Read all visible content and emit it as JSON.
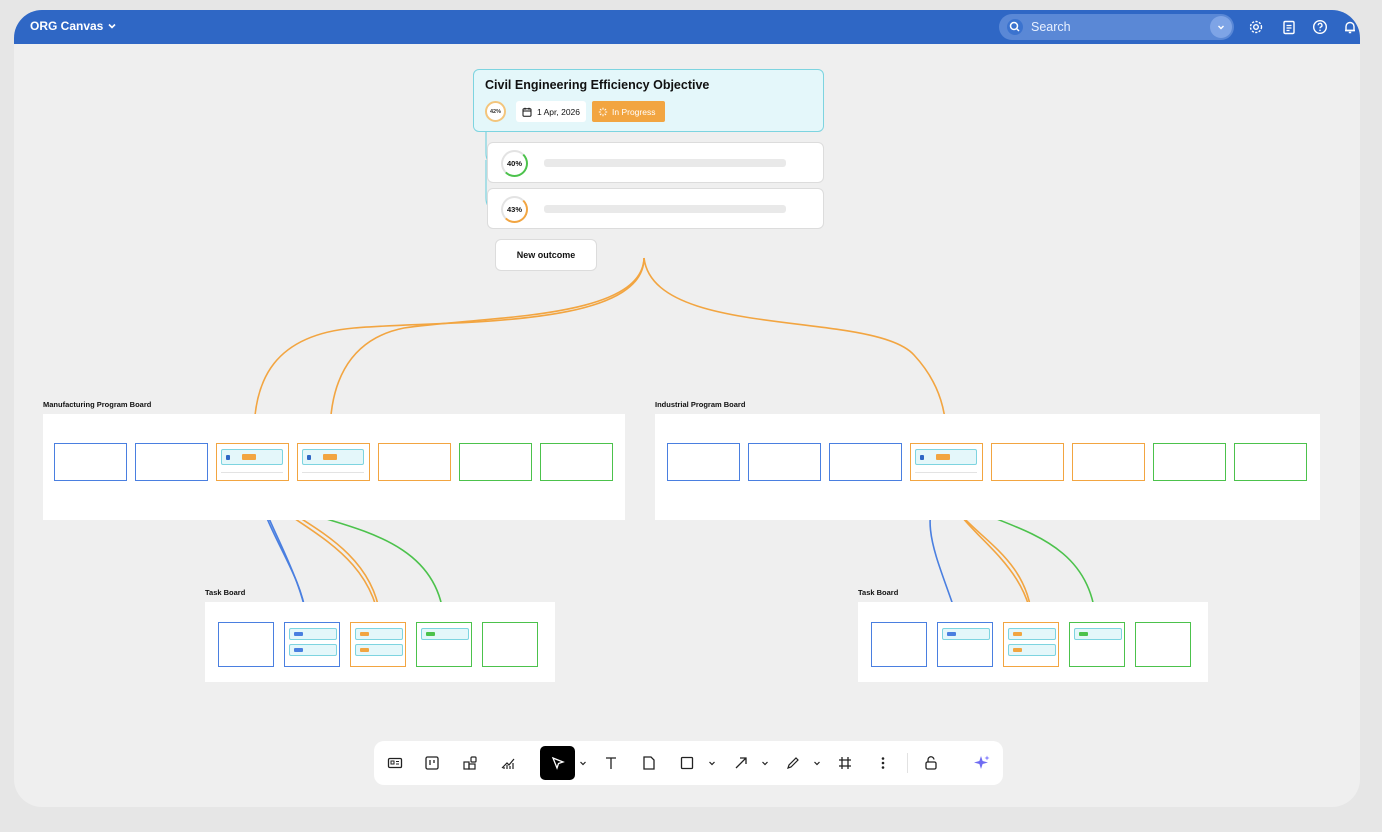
{
  "app": {
    "title": "ORG Canvas"
  },
  "search": {
    "placeholder": "Search"
  },
  "objective": {
    "title": "Civil Engineering Efficiency Objective",
    "progress": "42%",
    "date": "1 Apr, 2026",
    "status": "In Progress"
  },
  "outcomes": [
    {
      "progress": "40%",
      "ring_color": "#4cc24c"
    },
    {
      "progress": "43%",
      "ring_color": "#f2a541"
    }
  ],
  "new_outcome_label": "New outcome",
  "boards": {
    "manufacturing": {
      "label": "Manufacturing Program Board"
    },
    "industrial": {
      "label": "Industrial Program Board"
    },
    "task_left": {
      "label": "Task Board"
    },
    "task_right": {
      "label": "Task Board"
    }
  },
  "colors": {
    "topbar": "#2f67c5",
    "blue": "#4a7fe0",
    "orange": "#f2a541",
    "green": "#4cc24c",
    "cyan": "#7dd4e0"
  },
  "toolbar": {
    "tools": [
      "card-icon",
      "board-icon",
      "widgets-icon",
      "analytics-icon",
      "select-icon",
      "text-icon",
      "sticky-note-icon",
      "shape-icon",
      "arrow-icon",
      "pen-icon",
      "frame-icon",
      "more-icon",
      "lock-icon",
      "ai-sparkle-icon"
    ]
  }
}
